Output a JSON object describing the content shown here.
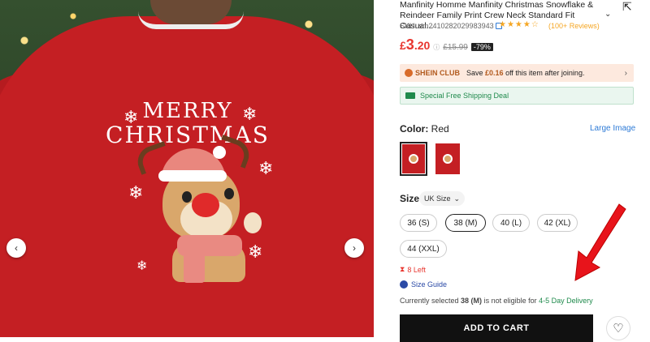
{
  "product": {
    "title": "Manfinity Homme Manfinity Christmas Snowflake & Reindeer Family Print Crew Neck Standard Fit Casual...",
    "sku_label": "SKU: sm2410282029983943",
    "stars": "★★★★☆",
    "reviews": "(100+ Reviews)",
    "price_currency": "£",
    "price_main": "3",
    "price_decimal": ".20",
    "old_price": "£15.99",
    "discount": "-79%"
  },
  "print": {
    "line1": "MERRY",
    "line2": "CHRISTMAS"
  },
  "club": {
    "badge": "SHEIN CLUB",
    "save_prefix": "Save ",
    "save_amount": "£0.16",
    "save_suffix": " off this item after joining."
  },
  "shipping": {
    "label": "Special Free Shipping Deal"
  },
  "color": {
    "label": "Color:",
    "value": "Red",
    "large_image": "Large Image"
  },
  "size": {
    "label": "Size",
    "unit_select": "UK Size",
    "options": [
      "36 (S)",
      "38 (M)",
      "40 (L)",
      "42 (XL)",
      "44 (XXL)"
    ],
    "selected": "38 (M)"
  },
  "stock": {
    "left": "8 Left"
  },
  "size_guide": "Size Guide",
  "eligibility": {
    "prefix": "Currently selected ",
    "selected": "38 (M)",
    "middle": " is not eligible for ",
    "delivery": "4-5 Day Delivery"
  },
  "add_to_cart": "ADD TO CART",
  "colors": {
    "price": "#e8362f",
    "accent_link": "#2d7ad6",
    "shipping_green": "#1f8a4c",
    "annotation_arrow": "#e8141b"
  }
}
